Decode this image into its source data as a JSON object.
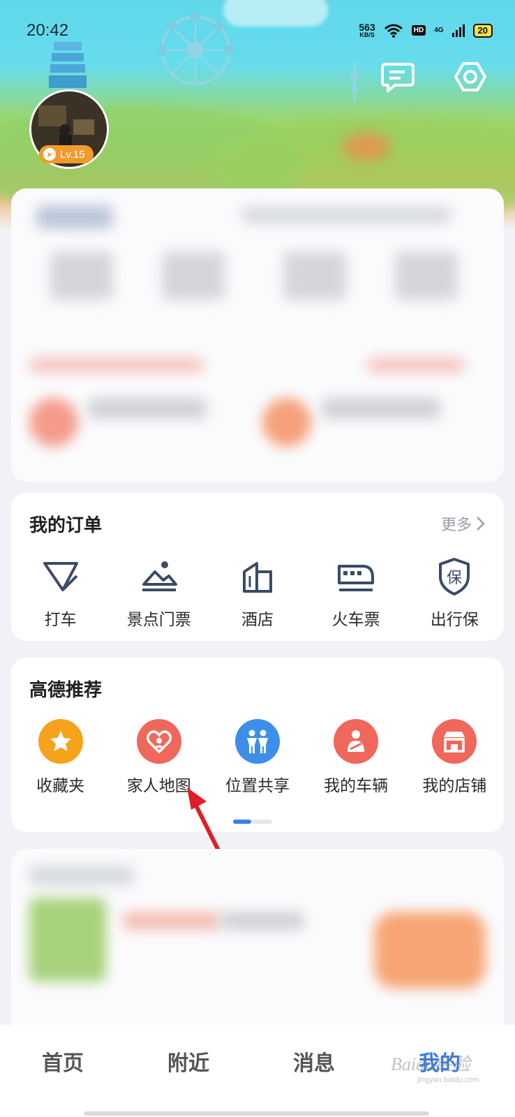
{
  "status_bar": {
    "time": "20:42",
    "net_speed_value": "563",
    "net_speed_unit": "KB/S",
    "hd_label": "HD",
    "network_label": "4G",
    "battery": "20"
  },
  "profile": {
    "level": "Lv.15"
  },
  "orders": {
    "title": "我的订单",
    "more": "更多",
    "items": [
      {
        "label": "打车",
        "icon": "taxi-icon"
      },
      {
        "label": "景点门票",
        "icon": "scenic-ticket-icon"
      },
      {
        "label": "酒店",
        "icon": "hotel-icon"
      },
      {
        "label": "火车票",
        "icon": "train-icon"
      },
      {
        "label": "出行保",
        "icon": "insurance-icon"
      }
    ]
  },
  "recommend": {
    "title": "高德推荐",
    "items": [
      {
        "label": "收藏夹",
        "icon": "star-icon",
        "color": "#f7a21b"
      },
      {
        "label": "家人地图",
        "icon": "family-heart-icon",
        "color": "#f0675b"
      },
      {
        "label": "位置共享",
        "icon": "people-share-icon",
        "color": "#3c8ee8"
      },
      {
        "label": "我的车辆",
        "icon": "vehicle-icon",
        "color": "#f0675b"
      },
      {
        "label": "我的店铺",
        "icon": "shop-icon",
        "color": "#f0675b"
      }
    ]
  },
  "bottom_nav": {
    "items": [
      "首页",
      "附近",
      "消息",
      "我的"
    ],
    "active_index": 3,
    "accent": "#3a7be6"
  },
  "watermark": {
    "text": "Baidu经验",
    "sub": "jingyan.baidu.com"
  }
}
